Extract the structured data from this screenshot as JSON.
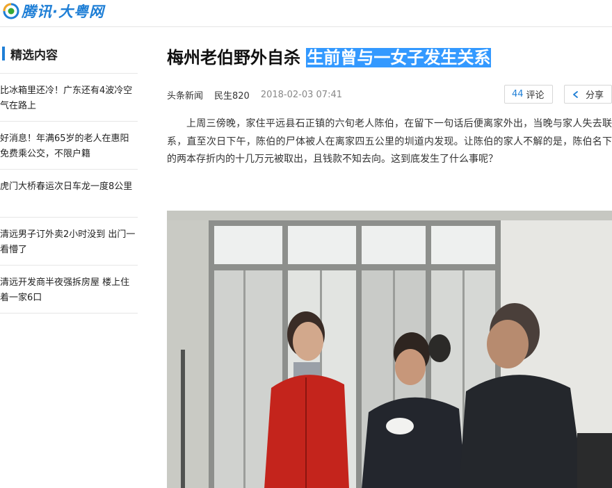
{
  "header": {
    "logo_text": "腾讯·大粤网",
    "logo_icon": "tencent-logo-icon",
    "brand_color": "#1f7fd6"
  },
  "sidebar": {
    "title": "精选内容",
    "items": [
      {
        "label": "比冰箱里还冷！广东还有4波冷空气在路上"
      },
      {
        "label": "好消息！年满65岁的老人在惠阳免费乘公交，不限户籍"
      },
      {
        "label": "虎门大桥春运次日车龙一度8公里"
      },
      {
        "label": "清远男子订外卖2小时没到 出门一看懵了"
      },
      {
        "label": "清远开发商半夜强拆房屋 楼上住着一家6口"
      }
    ]
  },
  "article": {
    "title_plain": "梅州老伯野外自杀",
    "title_selected": "生前曾与一女子发生关系",
    "selection_color": "#3399ff",
    "source": "头条新闻",
    "category": "民生820",
    "time": "2018-02-03 07:41",
    "comment_count": "44",
    "comment_label": "评论",
    "share_label": "分享",
    "share_icon": "share-icon",
    "paragraph": "上周三傍晚，家住平远县石正镇的六旬老人陈伯，在留下一句话后便离家外出，当晚与家人失去联系，直至次日下午，陈伯的尸体被人在离家四五公里的圳道内发现。让陈伯的家人不解的是，陈伯名下的两本存折内的十几万元被取出，且钱款不知去向。这到底发生了什么事呢？",
    "photo_description_icon": "news-photo"
  }
}
